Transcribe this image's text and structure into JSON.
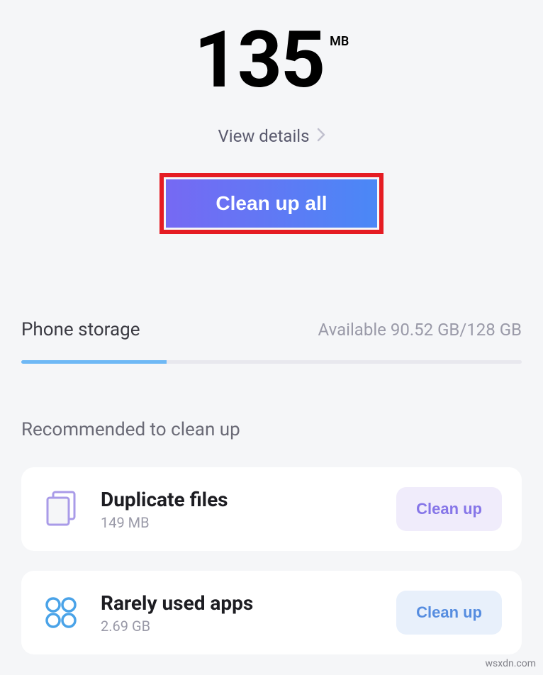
{
  "cleanup": {
    "size_value": "135",
    "size_unit": "MB",
    "view_details_label": "View details",
    "clean_all_label": "Clean up all"
  },
  "storage": {
    "title": "Phone storage",
    "available_label": "Available 90.52 GB/128 GB",
    "used_percent": 29
  },
  "recommended": {
    "title": "Recommended to clean up",
    "items": [
      {
        "icon": "duplicate-files-icon",
        "title": "Duplicate files",
        "sub": "149 MB",
        "btn_label": "Clean up",
        "btn_style": "purple"
      },
      {
        "icon": "rarely-used-apps-icon",
        "title": "Rarely used apps",
        "sub": "2.69 GB",
        "btn_label": "Clean up",
        "btn_style": "blue"
      }
    ]
  },
  "watermark": "wsxdn.com"
}
